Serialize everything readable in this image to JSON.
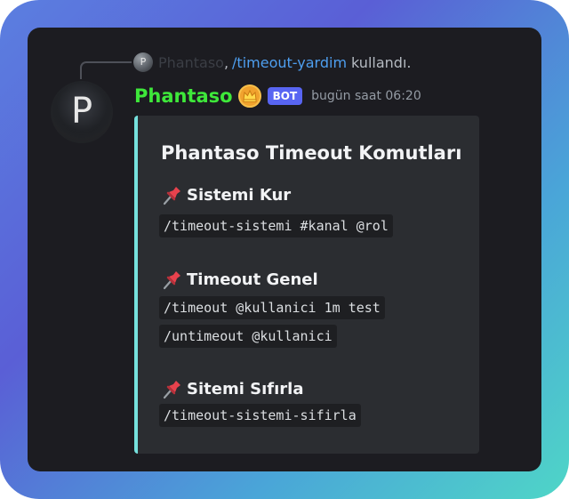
{
  "reply": {
    "avatar_letter": "P",
    "username": "Phantaso",
    "separator": ",",
    "command": "/timeout-yardim",
    "suffix": "kullandı."
  },
  "message": {
    "avatar_letter": "P",
    "username": "Phantaso",
    "username_color": "#3ee83a",
    "crown_icon": "crown-badge-icon",
    "badge": "BOT",
    "timestamp": "bugün saat 06:20"
  },
  "embed": {
    "accent_color": "#75e0dd",
    "title": "Phantaso Timeout Komutları",
    "fields": [
      {
        "icon": "pushpin-icon",
        "name": "Sistemi Kur",
        "commands": [
          "/timeout-sistemi #kanal @rol"
        ]
      },
      {
        "icon": "pushpin-icon",
        "name": "Timeout Genel",
        "commands": [
          "/timeout @kullanici 1m test",
          "/untimeout @kullanici"
        ]
      },
      {
        "icon": "pushpin-icon",
        "name": "Sitemi Sıfırla",
        "commands": [
          "/timeout-sistemi-sifirla"
        ]
      }
    ]
  }
}
